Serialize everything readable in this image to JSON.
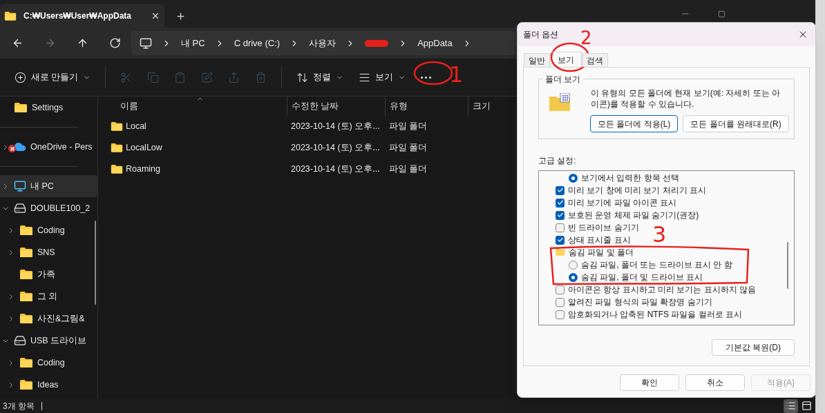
{
  "explorer": {
    "tab": {
      "title": "C:₩Users₩User₩AppData"
    },
    "nav": [
      {
        "kind": "back",
        "disabled": false
      },
      {
        "kind": "forward",
        "disabled": true
      },
      {
        "kind": "up",
        "disabled": false
      },
      {
        "kind": "refresh",
        "disabled": false
      }
    ],
    "breadcrumb": [
      {
        "kind": "pc"
      },
      {
        "kind": "text",
        "label": "내 PC"
      },
      {
        "kind": "text",
        "label": "C drive (C:)"
      },
      {
        "kind": "text",
        "label": "사용자"
      },
      {
        "kind": "redacted"
      },
      {
        "kind": "text",
        "label": "AppData"
      }
    ],
    "toolbar": [
      {
        "kind": "new",
        "label": "새로 만들기",
        "disabled": false
      },
      {
        "kind": "cut",
        "disabled": true
      },
      {
        "kind": "copy",
        "disabled": true
      },
      {
        "kind": "paste",
        "disabled": true
      },
      {
        "kind": "rename",
        "disabled": true
      },
      {
        "kind": "share",
        "disabled": true
      },
      {
        "kind": "delete",
        "disabled": true
      },
      {
        "kind": "sort",
        "label": "정렬",
        "disabled": false
      },
      {
        "kind": "view",
        "label": "보기",
        "disabled": false
      },
      {
        "kind": "more",
        "disabled": false
      }
    ],
    "sidebar": [
      {
        "kind": "folder",
        "label": "Settings",
        "expandable": false,
        "selected": false
      },
      {
        "kind": "divider"
      },
      {
        "kind": "cloud",
        "label": "OneDrive - Pers",
        "expandable": true,
        "expanded": false,
        "selected": false,
        "error": true
      },
      {
        "kind": "divider"
      },
      {
        "kind": "pc",
        "label": "내 PC",
        "expandable": true,
        "expanded": false,
        "selected": true
      },
      {
        "kind": "drive",
        "label": "DOUBLE100_2",
        "expandable": true,
        "expanded": true,
        "selected": false,
        "children": [
          {
            "kind": "folder",
            "label": "Coding",
            "expandable": true,
            "expanded": false,
            "selected": false
          },
          {
            "kind": "folder",
            "label": "SNS",
            "expandable": true,
            "expanded": false,
            "selected": false
          },
          {
            "kind": "folder",
            "label": "가족",
            "expandable": false,
            "selected": false
          },
          {
            "kind": "folder",
            "label": "그 외",
            "expandable": true,
            "expanded": false,
            "selected": false
          },
          {
            "kind": "folder",
            "label": "사진&그림&",
            "expandable": true,
            "expanded": false,
            "selected": false
          }
        ]
      },
      {
        "kind": "drive",
        "label": "USB 드라이브",
        "expandable": true,
        "expanded": true,
        "selected": false,
        "children": [
          {
            "kind": "folder",
            "label": "Coding",
            "expandable": true,
            "expanded": false,
            "selected": false
          },
          {
            "kind": "folder",
            "label": "Ideas",
            "expandable": true,
            "expanded": false,
            "selected": false
          }
        ]
      }
    ],
    "columns": [
      "이름",
      "수정한 날짜",
      "유형",
      "크기"
    ],
    "rows": [
      {
        "name": "Local",
        "modified": "2023-10-14 (토) 오후...",
        "type": "파일 폴더"
      },
      {
        "name": "LocalLow",
        "modified": "2023-10-14 (토) 오후...",
        "type": "파일 폴더"
      },
      {
        "name": "Roaming",
        "modified": "2023-10-14 (토) 오후...",
        "type": "파일 폴더"
      }
    ],
    "status_bar": {
      "count": "3개 항목",
      "views": [
        {
          "kind": "details",
          "selected": true
        },
        {
          "kind": "tiles",
          "selected": false
        }
      ]
    }
  },
  "dialog": {
    "title": "폴더 옵션",
    "tabs": [
      {
        "label": "일반",
        "selected": false
      },
      {
        "label": "보기",
        "selected": true
      },
      {
        "label": "검색",
        "selected": false
      }
    ],
    "folder_view": {
      "title": "폴더 보기",
      "description": "이 유형의 모든 폴더에 현재 보기(예: 자세히 또는 아이콘)를 적용할 수 있습니다.",
      "buttons": [
        {
          "label": "모든 폴더에 적용(L)",
          "default": true
        },
        {
          "label": "모든 폴더를 원래대로(R)",
          "default": false
        }
      ]
    },
    "advanced_label": "고급 설정:",
    "advanced": [
      {
        "kind": "radio",
        "label": "보기에서 입력한 항목 선택",
        "checked": true
      },
      {
        "kind": "checkbox",
        "label": "미리 보기 창에 미리 보기 처리기 표시",
        "checked": true
      },
      {
        "kind": "checkbox",
        "label": "미리 보기에 파일 아이콘 표시",
        "checked": true
      },
      {
        "kind": "checkbox",
        "label": "보호된 운영 체제 파일 숨기기(권장)",
        "checked": true
      },
      {
        "kind": "checkbox",
        "label": "빈 드라이브 숨기기",
        "checked": false
      },
      {
        "kind": "checkbox",
        "label": "상태 표시줄 표시",
        "checked": true
      },
      {
        "kind": "folder",
        "label": "숨김 파일 및 폴더",
        "children": [
          {
            "kind": "radio",
            "label": "숨김 파일, 폴더 또는 드라이브 표시 안 함",
            "checked": false
          },
          {
            "kind": "radio",
            "label": "숨김 파일, 폴더 및 드라이브 표시",
            "checked": true
          }
        ]
      },
      {
        "kind": "checkbox",
        "label": "아이콘은 항상 표시하고 미리 보기는 표시하지 않음",
        "checked": false
      },
      {
        "kind": "checkbox",
        "label": "알려진 파일 형식의 파일 확장명 숨기기",
        "checked": false
      },
      {
        "kind": "checkbox",
        "label": "암호화되거나 압축된 NTFS 파일을 컬러로 표시",
        "checked": false
      }
    ],
    "restore_button": "기본값 복원(D)",
    "buttons": [
      {
        "label": "확인",
        "disabled": false
      },
      {
        "label": "취소",
        "disabled": false
      },
      {
        "label": "적용(A)",
        "disabled": true
      }
    ]
  },
  "annotations": [
    {
      "text": "1"
    },
    {
      "text": "2"
    },
    {
      "text": "3"
    }
  ]
}
